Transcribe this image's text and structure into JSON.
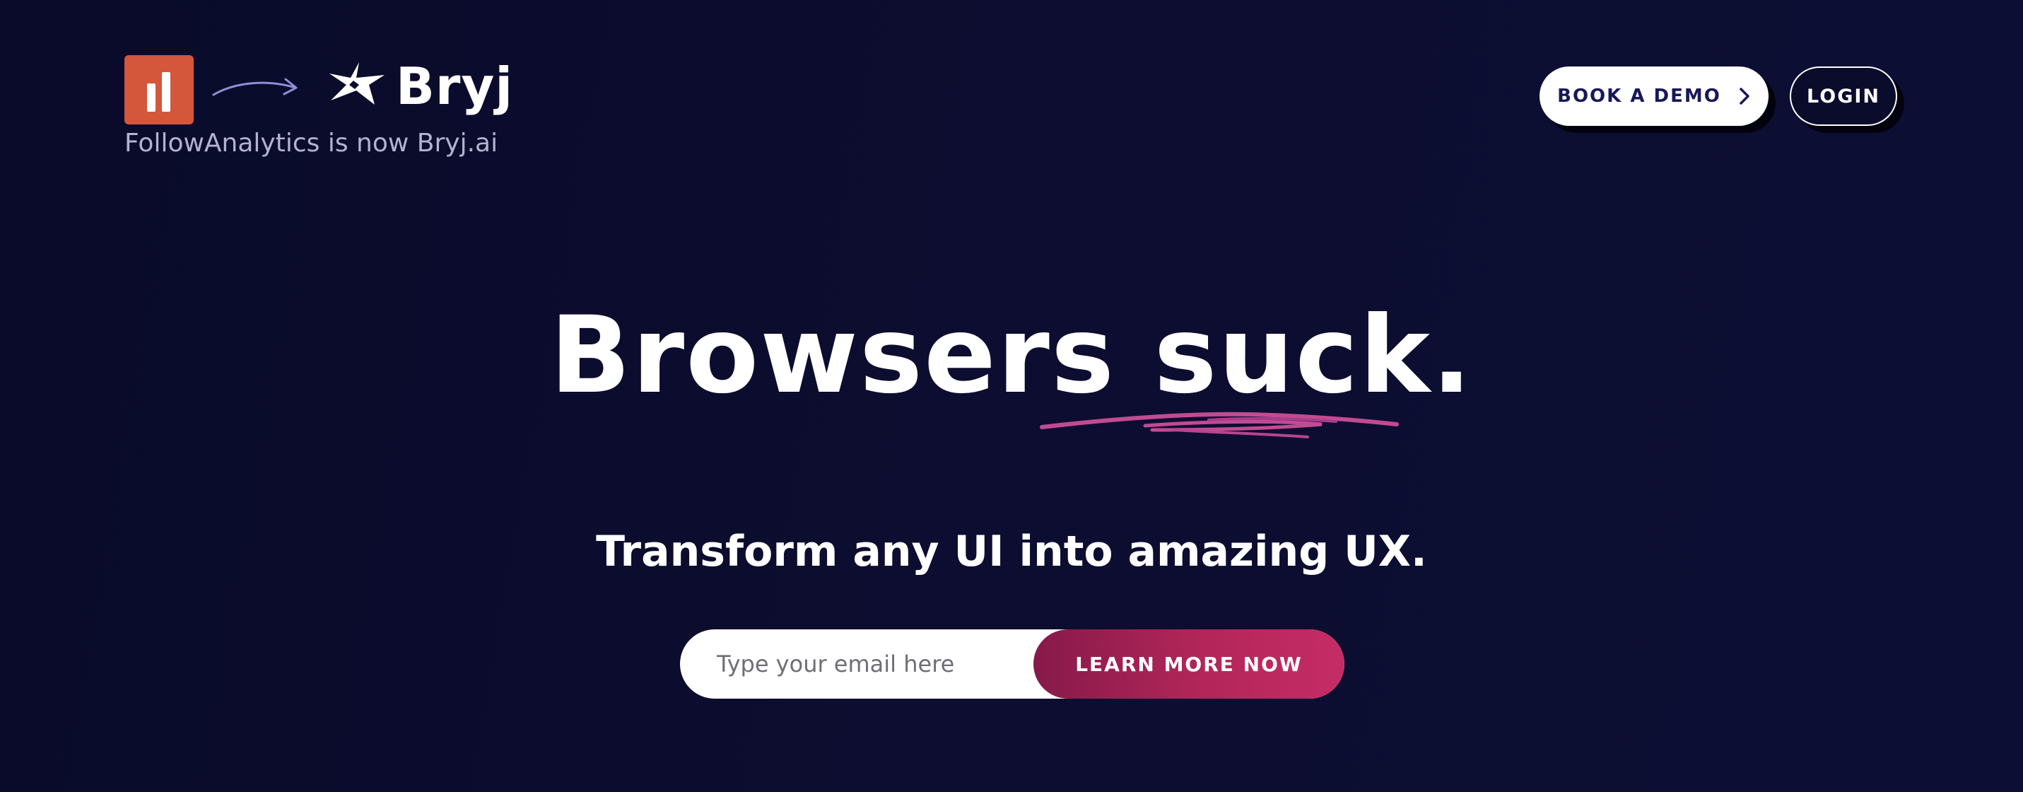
{
  "brand": {
    "old_logo_icon": "followanalytics-bar-chart-icon",
    "old_logo_color": "#d4563b",
    "transition_icon": "curved-arrow-right-icon",
    "new_logo_icon": "bryj-sparkle-icon",
    "new_name": "Bryj",
    "caption": "FollowAnalytics is now Bryj.ai"
  },
  "header": {
    "book_demo_label": "BOOK A DEMO",
    "book_demo_icon": "chevron-right-icon",
    "login_label": "LOGIN"
  },
  "hero": {
    "title": "Browsers suck.",
    "underline_icon": "pink-scribble-underline",
    "subtitle": "Transform any UI into amazing UX."
  },
  "form": {
    "email_placeholder": "Type your email here",
    "email_value": "",
    "submit_label": "LEARN MORE NOW"
  },
  "colors": {
    "background": "#0b0c2c",
    "accent": "#b32659",
    "button_text_dark": "#17185a",
    "caption_text": "#b2b3d0"
  }
}
